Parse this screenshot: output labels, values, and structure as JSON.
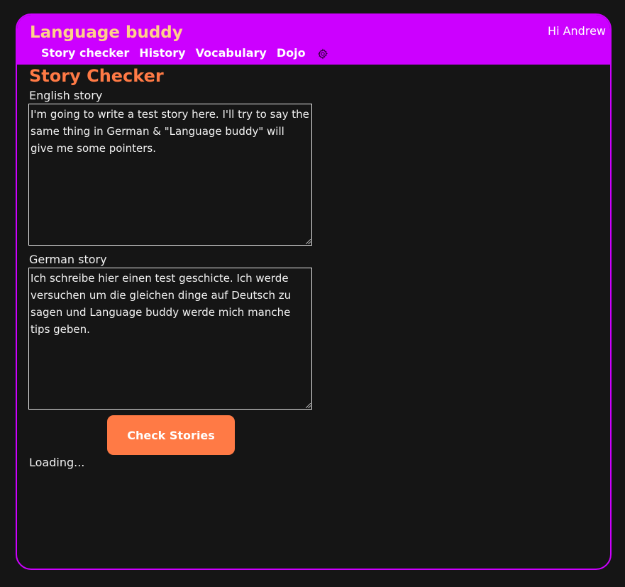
{
  "header": {
    "app_title": "Language buddy",
    "greeting": "Hi Andrew",
    "nav": [
      {
        "label": "Story checker"
      },
      {
        "label": "History"
      },
      {
        "label": "Vocabulary"
      },
      {
        "label": "Dojo"
      }
    ],
    "settings_icon": "gear-icon"
  },
  "main": {
    "title": "Story Checker",
    "english": {
      "label": "English story",
      "value": "I'm going to write a test story here. I'll try to say the same thing in German & \"Language buddy\" will give me some pointers."
    },
    "german": {
      "label": "German story",
      "value": "Ich schreibe hier einen test geschicte. Ich werde versuchen um die gleichen dinge auf Deutsch zu sagen und Language buddy werde mich manche tips geben."
    },
    "check_button": "Check Stories",
    "status": "Loading..."
  },
  "colors": {
    "background": "#151515",
    "accent": "#cc00ff",
    "title_orange": "#ff7a45",
    "app_title": "#ffd08a"
  }
}
